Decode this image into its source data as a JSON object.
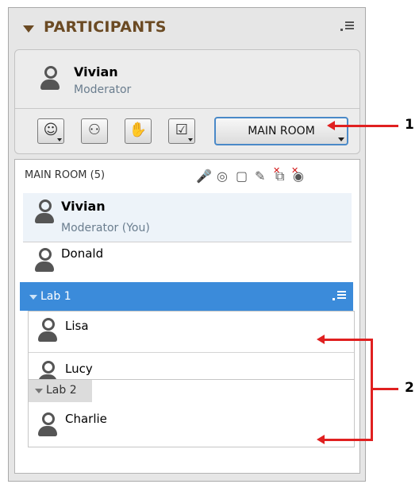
{
  "panel": {
    "title": "PARTICIPANTS"
  },
  "me": {
    "name": "Vivian",
    "role": "Moderator"
  },
  "toolbar": {
    "buttons": [
      {
        "name": "status-button",
        "glyph": "☺"
      },
      {
        "name": "presenter-button",
        "glyph": "⚇"
      },
      {
        "name": "raise-hand-button",
        "glyph": "✋"
      },
      {
        "name": "poll-button",
        "glyph": "☑"
      }
    ],
    "main_room_label": "MAIN ROOM"
  },
  "list": {
    "title": "MAIN ROOM (5)",
    "tool_icons": [
      {
        "name": "microphone-icon",
        "glyph": "🎤"
      },
      {
        "name": "video-icon",
        "glyph": "◎"
      },
      {
        "name": "chat-icon",
        "glyph": "▢"
      },
      {
        "name": "draw-icon",
        "glyph": "✎"
      },
      {
        "name": "share-icon",
        "glyph": "⧉"
      },
      {
        "name": "web-icon",
        "glyph": "◉"
      }
    ],
    "main_room": [
      {
        "name": "Vivian",
        "role": "Moderator (You)"
      },
      {
        "name": "Donald"
      }
    ],
    "groups": [
      {
        "label": "Lab 1",
        "members": [
          "Lisa",
          "Lucy"
        ]
      },
      {
        "label": "Lab 2",
        "members": [
          "Charlie"
        ]
      }
    ]
  },
  "annotations": {
    "callout_1": "1",
    "callout_2": "2",
    "color": "#e02020"
  },
  "colors": {
    "header_text": "#6b4a23",
    "selected_group": "#3b8bda",
    "moderator_row": "#edf3f9"
  }
}
